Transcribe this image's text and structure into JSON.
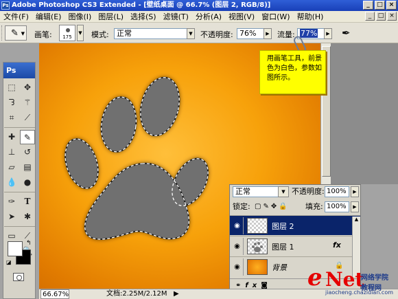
{
  "window": {
    "app_icon": "Ps",
    "title": "Adobe Photoshop CS3 Extended - [壁纸桌面 @ 66.7% (图层 2, RGB/8)]",
    "controls": [
      "_",
      "□",
      "×"
    ]
  },
  "menubar": {
    "items": [
      "文件(F)",
      "编辑(E)",
      "图像(I)",
      "图层(L)",
      "选择(S)",
      "滤镜(T)",
      "分析(A)",
      "视图(V)",
      "窗口(W)",
      "帮助(H)"
    ],
    "doc_controls": [
      "_",
      "□",
      "×"
    ]
  },
  "options_bar": {
    "brush_label": "画笔:",
    "brush_size": "175",
    "mode_label": "模式:",
    "mode_value": "正常",
    "opacity_label": "不透明度:",
    "opacity_value": "76%",
    "flow_label": "流量:",
    "flow_value": "77%"
  },
  "toolbox": {
    "header": "Ps",
    "tools": [
      "marquee-icon",
      "move-icon",
      "lasso-icon",
      "magic-wand-icon",
      "crop-icon",
      "eyedropper-icon",
      "healing-icon",
      "brush-icon",
      "stamp-icon",
      "history-brush-icon",
      "eraser-icon",
      "gradient-icon",
      "blur-icon",
      "dodge-icon",
      "pen-icon",
      "type-icon",
      "path-select-icon",
      "shape-icon",
      "notes-icon",
      "eyedropper2-icon",
      "hand-icon",
      "zoom-icon"
    ],
    "foreground_color": "#ffffff",
    "background_color": "#000000"
  },
  "callout": {
    "text": "用画笔工具，前景色为白色，参数如图所示。"
  },
  "layers_panel": {
    "blend_mode": "正常",
    "opacity_label": "不透明度:",
    "opacity_value": "100%",
    "lock_label": "锁定:",
    "fill_label": "填充:",
    "fill_value": "100%",
    "layers": [
      {
        "name": "图层 2",
        "active": true,
        "thumb": "transparent"
      },
      {
        "name": "图层 1",
        "active": false,
        "thumb": "paw",
        "fx": "fx"
      },
      {
        "name": "背景",
        "active": false,
        "thumb": "orange",
        "locked": true
      }
    ],
    "footer_icons": [
      "link-icon",
      "fx-icon",
      "mask-icon"
    ]
  },
  "statusbar": {
    "zoom": "66.67%",
    "doc_info": "文档:2.25M/2.12M"
  },
  "watermark": {
    "brand_e": "e",
    "brand_net": "Net",
    "cn_text": "网络学院",
    "sub_text": "教程网",
    "url": "jiaocheng.chazidian.com"
  },
  "colors": {
    "canvas_center": "#ffbf3a",
    "canvas_edge": "#cf6a00",
    "paw_fill": "#6f6f6f",
    "active_layer": "#0a246a",
    "callout_bg": "#ffff00"
  }
}
